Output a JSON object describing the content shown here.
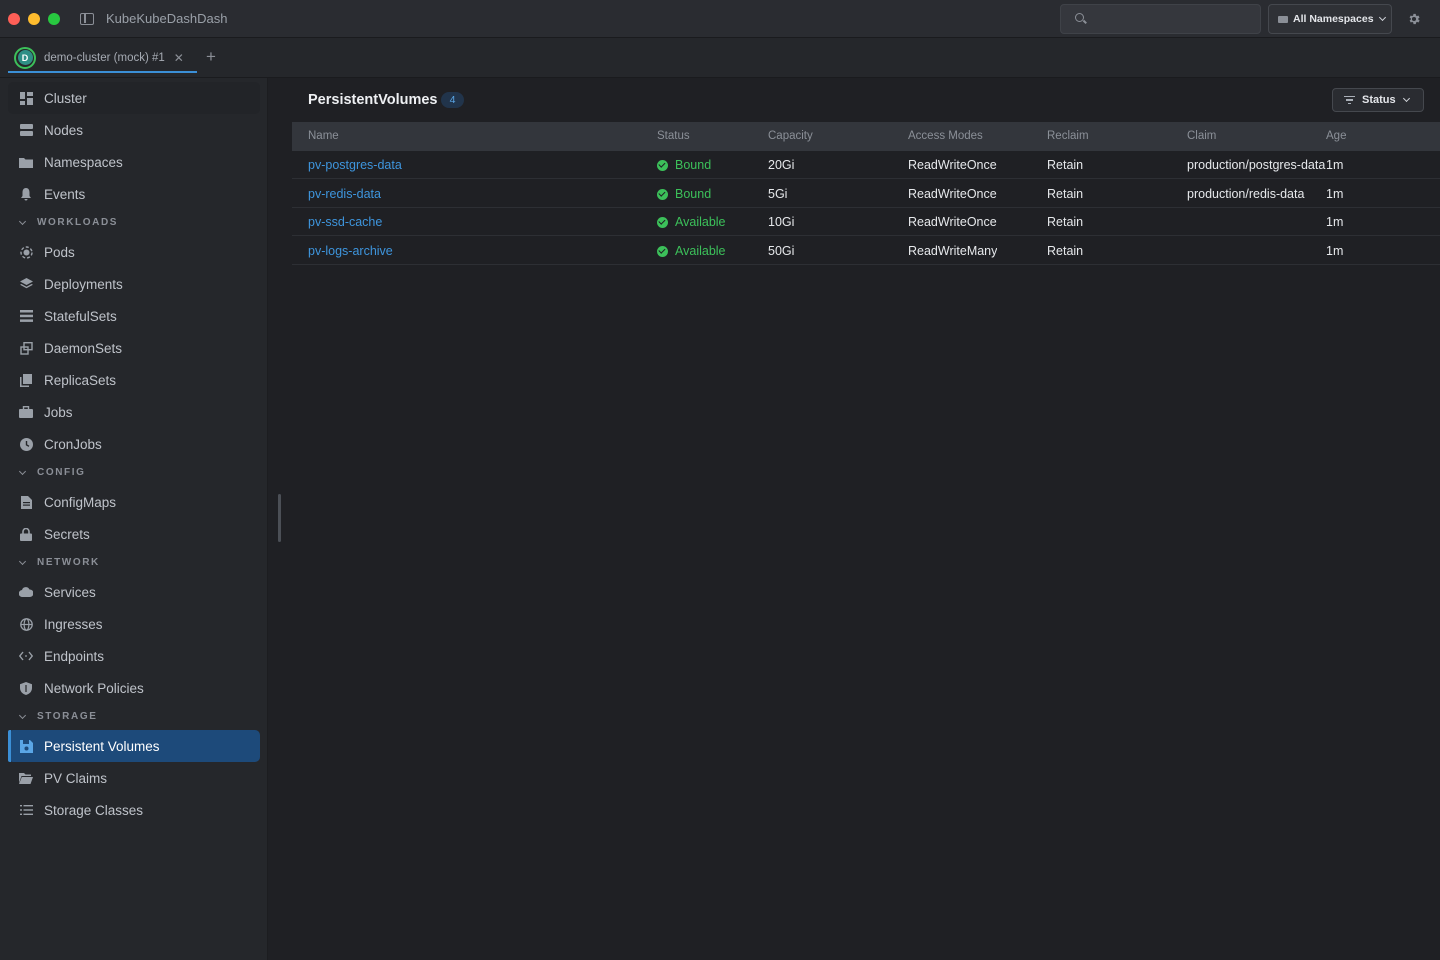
{
  "app": {
    "title": "KubeKubeDashDash"
  },
  "search": {
    "value": "",
    "placeholder": ""
  },
  "namespace_select": {
    "label": "All Namespaces"
  },
  "tabs": [
    {
      "label": "demo-cluster (mock) #1",
      "badge": "D"
    }
  ],
  "sidebar": {
    "top_items": [
      "Cluster",
      "Nodes",
      "Namespaces",
      "Events"
    ],
    "sections": [
      {
        "title": "WORKLOADS",
        "items": [
          "Pods",
          "Deployments",
          "StatefulSets",
          "DaemonSets",
          "ReplicaSets",
          "Jobs",
          "CronJobs"
        ]
      },
      {
        "title": "CONFIG",
        "items": [
          "ConfigMaps",
          "Secrets"
        ]
      },
      {
        "title": "NETWORK",
        "items": [
          "Services",
          "Ingresses",
          "Endpoints",
          "Network Policies"
        ]
      },
      {
        "title": "STORAGE",
        "items": [
          "Persistent Volumes",
          "PV Claims",
          "Storage Classes"
        ]
      }
    ],
    "active": "Persistent Volumes"
  },
  "main": {
    "title": "PersistentVolumes",
    "count": "4",
    "filter_label": "Status",
    "columns": [
      "Name",
      "Status",
      "Capacity",
      "Access Modes",
      "Reclaim",
      "Claim",
      "Age"
    ],
    "rows": [
      {
        "name": "pv-postgres-data",
        "status": "Bound",
        "capacity": "20Gi",
        "access": "ReadWriteOnce",
        "reclaim": "Retain",
        "claim": "production/postgres-data",
        "age": "1m"
      },
      {
        "name": "pv-redis-data",
        "status": "Bound",
        "capacity": "5Gi",
        "access": "ReadWriteOnce",
        "reclaim": "Retain",
        "claim": "production/redis-data",
        "age": "1m"
      },
      {
        "name": "pv-ssd-cache",
        "status": "Available",
        "capacity": "10Gi",
        "access": "ReadWriteOnce",
        "reclaim": "Retain",
        "claim": "",
        "age": "1m"
      },
      {
        "name": "pv-logs-archive",
        "status": "Available",
        "capacity": "50Gi",
        "access": "ReadWriteMany",
        "reclaim": "Retain",
        "claim": "",
        "age": "1m"
      }
    ]
  },
  "colors": {
    "accent": "#3b8fd6",
    "active_bg": "#1d4a7a",
    "status_ok": "#3cc05a",
    "link": "#3e95dd"
  }
}
